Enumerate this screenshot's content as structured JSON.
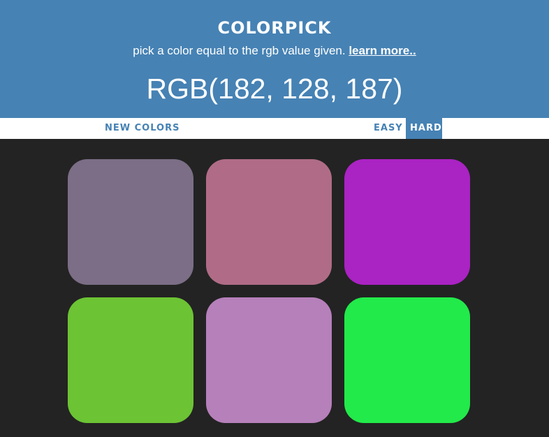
{
  "header": {
    "title": "COLORPICK",
    "subtitle_text": "pick a color equal to the rgb value given.",
    "learn_more": "learn more..",
    "rgb_target": "RGB(182, 128, 187)",
    "background_color": "#4682b4"
  },
  "controls": {
    "new_colors": "NEW COLORS",
    "easy": "EASY",
    "hard": "HARD",
    "selected_mode": "HARD"
  },
  "squares": [
    {
      "color": "#7b6e86"
    },
    {
      "color": "#b06c86"
    },
    {
      "color": "#aa23c3"
    },
    {
      "color": "#6cc334"
    },
    {
      "color": "#b680bb"
    },
    {
      "color": "#22ea4a"
    }
  ],
  "page_background": "#232323"
}
